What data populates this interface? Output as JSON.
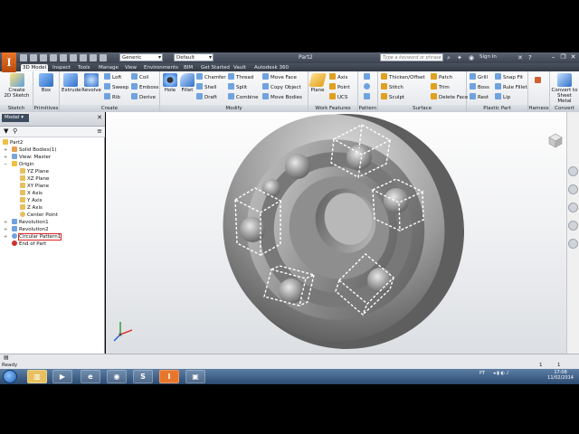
{
  "app": {
    "document_title": "Part2",
    "style_combo": "Generic",
    "material_combo": "Default",
    "search_placeholder": "Type a keyword or phrase",
    "sign_in": "Sign In",
    "brand_color": "#e8762a"
  },
  "tabs": [
    "3D Model",
    "Inspect",
    "Tools",
    "Manage",
    "View",
    "Environments",
    "BIM",
    "Get Started",
    "Vault",
    "Autodesk 360"
  ],
  "ribbon": {
    "sketch": {
      "title": "Sketch",
      "create_label": "Create",
      "create_label2": "2D Sketch"
    },
    "primitives": {
      "title": "Primitives",
      "box": "Box"
    },
    "create": {
      "title": "Create",
      "extrude": "Extrude",
      "revolve": "Revolve",
      "loft": "Loft",
      "sweep": "Sweep",
      "rib": "Rib",
      "coil": "Coil",
      "emboss": "Emboss",
      "derive": "Derive"
    },
    "modify": {
      "title": "Modify",
      "hole": "Hole",
      "fillet": "Fillet",
      "chamfer": "Chamfer",
      "shell": "Shell",
      "draft": "Draft",
      "thread": "Thread",
      "split": "Split",
      "combine": "Combine",
      "move_face": "Move Face",
      "copy_object": "Copy Object",
      "move_bodies": "Move Bodies"
    },
    "work_features": {
      "title": "Work Features",
      "plane": "Plane",
      "axis": "Axis",
      "point": "Point",
      "ucs": "UCS"
    },
    "pattern": {
      "title": "Pattern"
    },
    "surface": {
      "title": "Surface",
      "thicken": "Thicken/Offset",
      "stitch": "Stitch",
      "sculpt": "Sculpt",
      "patch": "Patch",
      "trim": "Trim",
      "delete_face": "Delete Face"
    },
    "plastic": {
      "title": "Plastic Part",
      "grill": "Grill",
      "boss": "Boss",
      "rest": "Rest",
      "snap_fit": "Snap Fit",
      "rule_fillet": "Rule Fillet",
      "lip": "Lip"
    },
    "harness": {
      "title": "Harness"
    },
    "convert": {
      "title": "Convert",
      "label1": "Convert to",
      "label2": "Sheet Metal"
    }
  },
  "browser": {
    "tab": "Model",
    "items": [
      {
        "label": "Part2"
      },
      {
        "label": "Solid Bodies(1)"
      },
      {
        "label": "View: Master"
      },
      {
        "label": "Origin"
      },
      {
        "label": "YZ Plane"
      },
      {
        "label": "XZ Plane"
      },
      {
        "label": "XY Plane"
      },
      {
        "label": "X Axis"
      },
      {
        "label": "Y Axis"
      },
      {
        "label": "Z Axis"
      },
      {
        "label": "Center Point"
      },
      {
        "label": "Revolution1"
      },
      {
        "label": "Revolution2"
      },
      {
        "label": "Circular Pattern1"
      },
      {
        "label": "End of Part"
      }
    ]
  },
  "status": {
    "text": "Ready",
    "count1": "1",
    "count2": "1"
  },
  "taskbar": {
    "lang": "PT",
    "time": "17:08",
    "date": "11/02/2014"
  }
}
